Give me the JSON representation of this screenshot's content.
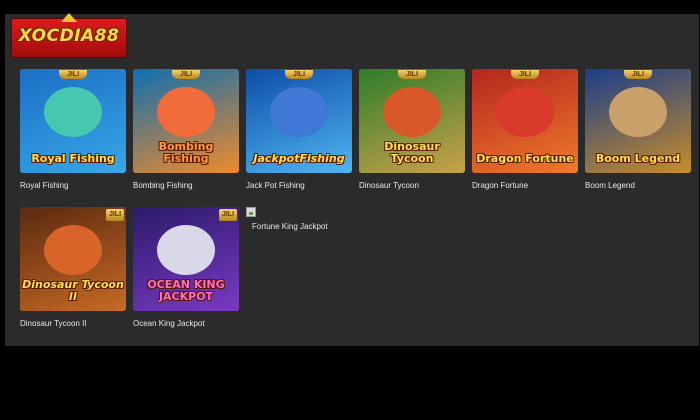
{
  "brand": {
    "logo_text": "XOCDIA88"
  },
  "badge_text": "JILI",
  "games": [
    {
      "name": "Royal Fishing",
      "art_title": "Royal Fishing",
      "colors": [
        "#1b6fc4",
        "#37a7e8"
      ],
      "char_color": "#45c7b0",
      "icon": "dragon-fish-icon"
    },
    {
      "name": "Bombing Fishing",
      "art_title": "Bombing Fishing",
      "colors": [
        "#0e6fb0",
        "#f08a2a"
      ],
      "char_color": "#f26b3a",
      "icon": "bomb-fish-icon"
    },
    {
      "name": "Jack Pot Fishing",
      "art_title": "JackpotFishing",
      "colors": [
        "#0d4da8",
        "#4fb6f0"
      ],
      "char_color": "#3f78d6",
      "icon": "shark-icon"
    },
    {
      "name": "Dinosaur Tycoon",
      "art_title": "Dinosaur Tycoon",
      "colors": [
        "#2f7d2a",
        "#c9a24a"
      ],
      "char_color": "#d9582a",
      "icon": "dinosaur-icon"
    },
    {
      "name": "Dragon Fortune",
      "art_title": "Dragon Fortune",
      "colors": [
        "#b5261e",
        "#ee7a2a"
      ],
      "char_color": "#d83a2c",
      "icon": "dragon-icon"
    },
    {
      "name": "Boom Legend",
      "art_title": "Boom Legend",
      "colors": [
        "#1a3e8a",
        "#c88c2a"
      ],
      "char_color": "#caa16a",
      "icon": "warrior-icon"
    },
    {
      "name": "Dinosaur Tycoon II",
      "art_title": "Dinosaur Tycoon II",
      "colors": [
        "#5a2a10",
        "#c86a24"
      ],
      "char_color": "#d8642a",
      "icon": "dinosaur-icon"
    },
    {
      "name": "Ocean King Jackpot",
      "art_title": "OCEAN KING JACKPOT",
      "colors": [
        "#2a1a6a",
        "#7a3ac4"
      ],
      "char_color": "#d8d8e8",
      "icon": "skeleton-pirate-icon"
    }
  ],
  "broken_game": {
    "name": "Fortune King Jackpot"
  }
}
